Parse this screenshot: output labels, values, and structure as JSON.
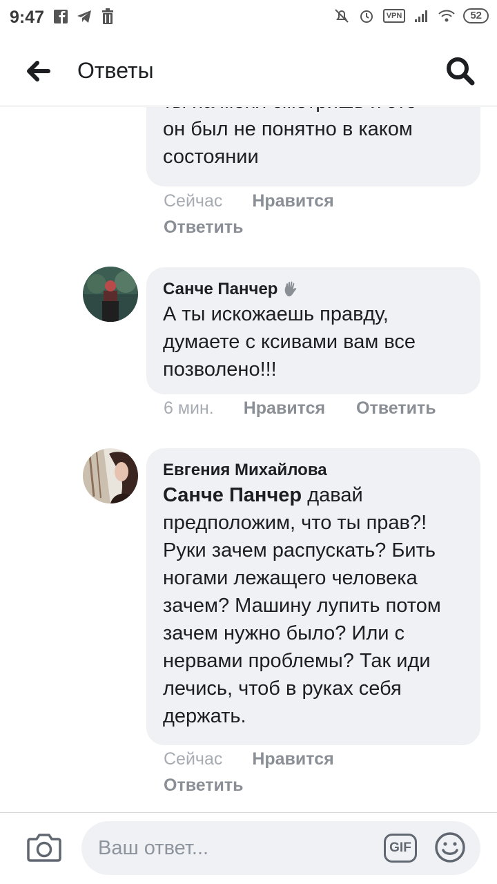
{
  "status_bar": {
    "time": "9:47",
    "vpn": "VPN",
    "battery": "52"
  },
  "header": {
    "back_icon": "arrow-left-icon",
    "title": "Ответы",
    "search_icon": "search-icon"
  },
  "comments": [
    {
      "author": "",
      "text": "Ты на меня смотришь и это он был не понятно в каком состоянии",
      "visible_lines": [
        "ты на меня смотришь  и это",
        "он был не понятно в каком",
        "состоянии"
      ],
      "time": "Сейчас",
      "like_label": "Нравится",
      "reply_label": "Ответить"
    },
    {
      "author": "Санче Панчер",
      "author_badge_icon": "waving-hand-icon",
      "text": "А ты искожаешь правду, думаете с ксивами вам все позволено!!!",
      "time": "6 мин.",
      "like_label": "Нравится",
      "reply_label": "Ответить"
    },
    {
      "author": "Евгения Михайлова",
      "mention": "Санче Панчер",
      "text": "давай предположим, что ты прав?! Руки зачем распускать? Бить ногами лежащего человека зачем? Машину лупить потом зачем нужно было? Или с нервами проблемы? Так иди лечись, чтоб в руках себя держать.",
      "time": "Сейчас",
      "like_label": "Нравится",
      "reply_label": "Ответить"
    }
  ],
  "composer": {
    "camera_icon": "camera-icon",
    "placeholder": "Ваш ответ...",
    "gif_label": "GIF",
    "emoji_icon": "smile-icon"
  },
  "colors": {
    "bubble": "#f0f1f4",
    "meta": "#8d949e",
    "text": "#1c1e21"
  }
}
